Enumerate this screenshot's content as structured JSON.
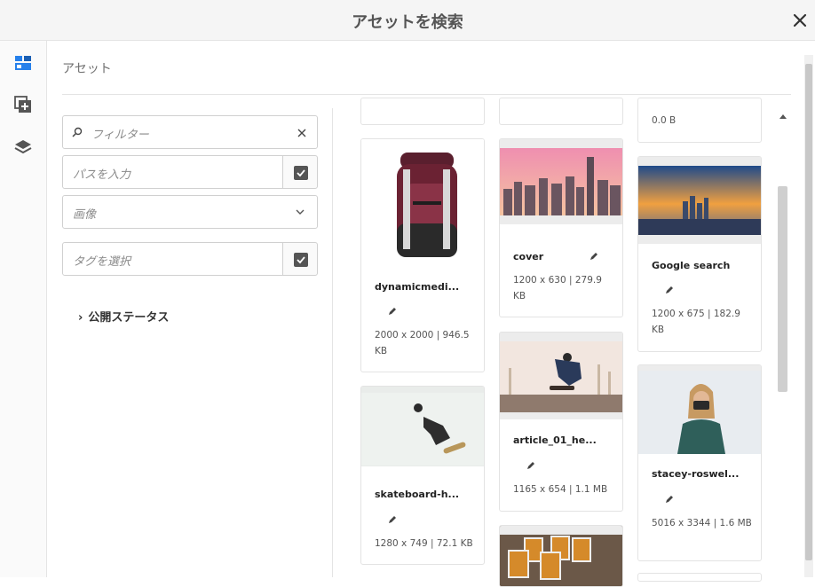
{
  "dialog": {
    "title": "アセットを検索",
    "close_icon": "close-icon"
  },
  "rail": {
    "icons": [
      "assets-icon",
      "add-collection-icon",
      "layers-icon"
    ]
  },
  "panel": {
    "title": "アセット",
    "filter_placeholder": "フィルター",
    "path_placeholder": "パスを入力",
    "type_value": "画像",
    "tag_placeholder": "タグを選択",
    "publish_status_label": "公開ステータス"
  },
  "grid": {
    "top_partial": {
      "meta": "0.0 B"
    },
    "cards": [
      {
        "name": "dynamicmedi...",
        "meta": "2000 x 2000 | 946.5 KB"
      },
      {
        "name": "skateboard-h...",
        "meta": "1280 x 749 | 72.1 KB"
      },
      {
        "name": "cover",
        "meta": "1200 x 630 | 279.9 KB"
      },
      {
        "name": "article_01_he...",
        "meta": "1165 x 654 | 1.1 MB"
      },
      {
        "name": "Google search",
        "meta": "1200 x 675 | 182.9 KB"
      },
      {
        "name": "stacey-roswel...",
        "meta": "5016 x 3344 | 1.6 MB"
      }
    ]
  },
  "colors": {
    "accent": "#2680eb",
    "text": "#323232",
    "muted": "#707070",
    "border": "#e4e4e4"
  }
}
